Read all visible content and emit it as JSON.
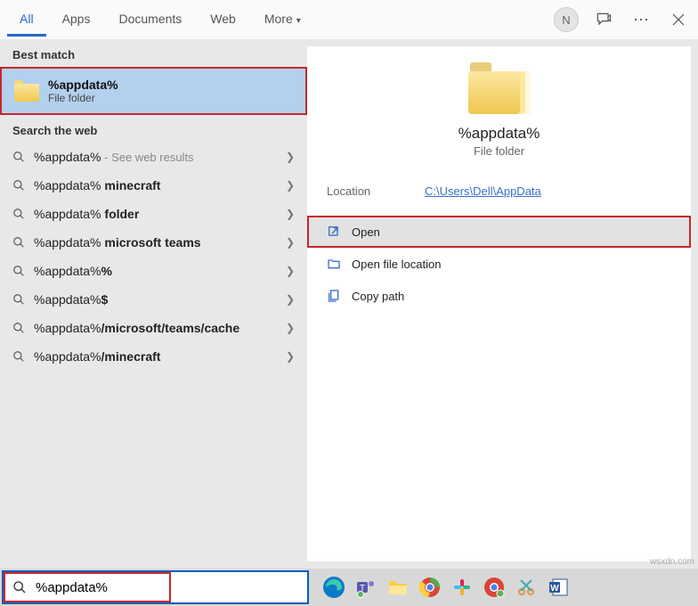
{
  "header": {
    "tabs": [
      "All",
      "Apps",
      "Documents",
      "Web",
      "More"
    ],
    "avatar_initial": "N"
  },
  "left": {
    "best_match_label": "Best match",
    "best_match": {
      "title": "%appdata%",
      "subtitle": "File folder"
    },
    "search_web_label": "Search the web",
    "web_results": [
      {
        "prefix": "%appdata%",
        "suffix": "",
        "hint": " - See web results"
      },
      {
        "prefix": "%appdata%",
        "suffix": " minecraft",
        "hint": ""
      },
      {
        "prefix": "%appdata%",
        "suffix": " folder",
        "hint": ""
      },
      {
        "prefix": "%appdata%",
        "suffix": " microsoft teams",
        "hint": ""
      },
      {
        "prefix": "%appdata%",
        "suffix": "%",
        "hint": ""
      },
      {
        "prefix": "%appdata%",
        "suffix": "$",
        "hint": ""
      },
      {
        "prefix": "%appdata%",
        "suffix": "/microsoft/teams/cache",
        "hint": ""
      },
      {
        "prefix": "%appdata%",
        "suffix": "/minecraft",
        "hint": ""
      }
    ]
  },
  "preview": {
    "title": "%appdata%",
    "subtitle": "File folder",
    "location_label": "Location",
    "location_value": "C:\\Users\\Dell\\AppData",
    "actions": [
      {
        "icon": "open-icon",
        "label": "Open",
        "highlight": true
      },
      {
        "icon": "open-location-icon",
        "label": "Open file location",
        "highlight": false
      },
      {
        "icon": "copy-path-icon",
        "label": "Copy path",
        "highlight": false
      }
    ]
  },
  "search": {
    "value": "%appdata%"
  },
  "taskbar_apps": [
    "edge",
    "teams",
    "files",
    "chrome",
    "slack",
    "chrome2",
    "snip",
    "word"
  ],
  "watermark": "wsxdn.com"
}
